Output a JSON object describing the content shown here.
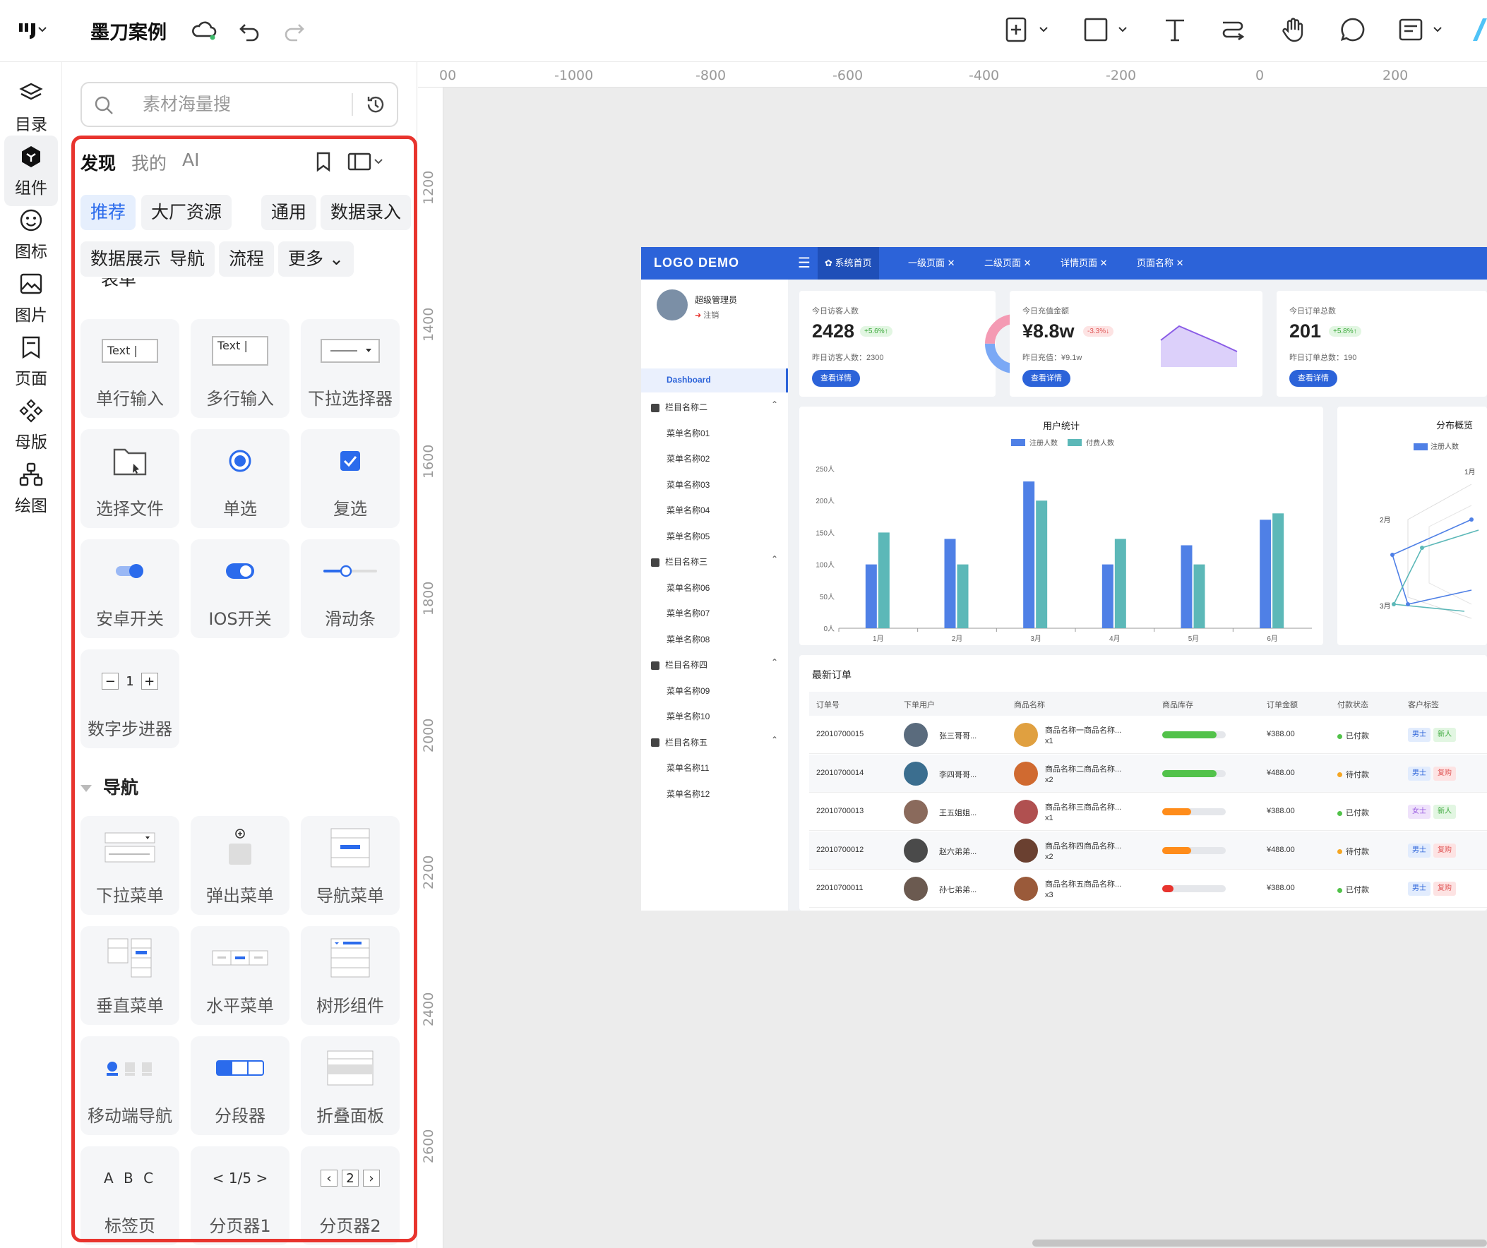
{
  "app": {
    "title": "墨刀案例"
  },
  "rail": [
    {
      "label": "目录",
      "icon": "layers-icon"
    },
    {
      "label": "组件",
      "icon": "component-icon",
      "active": true
    },
    {
      "label": "图标",
      "icon": "smiley-icon"
    },
    {
      "label": "图片",
      "icon": "image-icon"
    },
    {
      "label": "页面",
      "icon": "page-icon"
    },
    {
      "label": "母版",
      "icon": "master-icon"
    },
    {
      "label": "绘图",
      "icon": "draw-icon"
    }
  ],
  "rail_more": "···",
  "panel": {
    "search_placeholder": "素材海量搜",
    "tabs": [
      "发现",
      "我的",
      "AI"
    ],
    "chips": [
      "推荐",
      "大厂资源",
      "通用",
      "数据录入",
      "数据展示",
      "导航",
      "流程",
      "更多"
    ],
    "section_cut": "表单",
    "form_cards": [
      {
        "label": "单行输入",
        "preview": "Text |"
      },
      {
        "label": "多行输入",
        "preview": "Text |"
      },
      {
        "label": "下拉选择器"
      },
      {
        "label": "选择文件"
      },
      {
        "label": "单选"
      },
      {
        "label": "复选"
      },
      {
        "label": "安卓开关"
      },
      {
        "label": "IOS开关"
      },
      {
        "label": "滑动条"
      },
      {
        "label": "数字步进器",
        "preview": "1"
      }
    ],
    "nav_section": "导航",
    "nav_cards": [
      {
        "label": "下拉菜单"
      },
      {
        "label": "弹出菜单"
      },
      {
        "label": "导航菜单"
      },
      {
        "label": "垂直菜单"
      },
      {
        "label": "水平菜单"
      },
      {
        "label": "树形组件"
      },
      {
        "label": "移动端导航"
      },
      {
        "label": "分段器"
      },
      {
        "label": "折叠面板"
      },
      {
        "label": "标签页",
        "preview": "A B C"
      },
      {
        "label": "分页器1",
        "preview": "< 1/5 >"
      },
      {
        "label": "分页器2",
        "preview": "2"
      }
    ]
  },
  "rulers": {
    "top": [
      "00",
      "-1000",
      "-800",
      "-600",
      "-400",
      "-200",
      "0",
      "200"
    ],
    "left": [
      "1200",
      "1400",
      "1600",
      "1800",
      "2000",
      "2200",
      "2400",
      "2600"
    ]
  },
  "dashboard": {
    "logo": "LOGO DEMO",
    "tabs": [
      "系统首页",
      "一级页面 ✕",
      "二级页面 ✕",
      "详情页面 ✕",
      "页面名称 ✕"
    ],
    "user": {
      "name": "超级管理员",
      "logout": "注销"
    },
    "menu_active": "Dashboard",
    "menu": [
      {
        "group": "栏目名称二",
        "items": [
          "菜单名称01",
          "菜单名称02",
          "菜单名称03",
          "菜单名称04",
          "菜单名称05"
        ]
      },
      {
        "group": "栏目名称三",
        "items": [
          "菜单名称06",
          "菜单名称07",
          "菜单名称08"
        ]
      },
      {
        "group": "栏目名称四",
        "items": [
          "菜单名称09",
          "菜单名称10"
        ]
      },
      {
        "group": "栏目名称五",
        "items": [
          "菜单名称11",
          "菜单名称12"
        ]
      }
    ],
    "kpis": [
      {
        "title": "今日访客人数",
        "value": "2428",
        "badge": "+5.6%↑",
        "sub": "昨日访客人数：2300",
        "btn": "查看详情"
      },
      {
        "title": "今日充值金额",
        "value": "¥8.8w",
        "badge": "-3.3%↓",
        "sub": "昨日充值：¥9.1w",
        "btn": "查看详情"
      },
      {
        "title": "今日订单总数",
        "value": "201",
        "badge": "+5.8%↑",
        "sub": "昨日订单总数：190",
        "btn": "查看详情"
      }
    ],
    "radar": {
      "title": "分布概览",
      "legend": "注册人数",
      "axes": [
        "1月",
        "2月",
        "3月"
      ]
    },
    "orders": {
      "title": "最新订单",
      "headers": [
        "订单号",
        "下单用户",
        "商品名称",
        "商品库存",
        "订单金额",
        "付款状态",
        "客户标签"
      ],
      "rows": [
        {
          "id": "22010700015",
          "user": "张三哥哥...",
          "product": "商品名称一商品名称...",
          "qty": "x1",
          "stock": 0.85,
          "stock_color": "#52c24a",
          "amount": "¥388.00",
          "status": "已付款",
          "status_color": "#52c24a",
          "tag1": "男士",
          "tag2": "新人"
        },
        {
          "id": "22010700014",
          "user": "李四哥哥...",
          "product": "商品名称二商品名称...",
          "qty": "x2",
          "stock": 0.85,
          "stock_color": "#52c24a",
          "amount": "¥488.00",
          "status": "待付款",
          "status_color": "#f5a623",
          "tag1": "男士",
          "tag2": "复购"
        },
        {
          "id": "22010700013",
          "user": "王五姐姐...",
          "product": "商品名称三商品名称...",
          "qty": "x1",
          "stock": 0.45,
          "stock_color": "#ff8c1a",
          "amount": "¥388.00",
          "status": "已付款",
          "status_color": "#52c24a",
          "tag1": "女士",
          "tag2": "新人"
        },
        {
          "id": "22010700012",
          "user": "赵六弟弟...",
          "product": "商品名称四商品名称...",
          "qty": "x2",
          "stock": 0.45,
          "stock_color": "#ff8c1a",
          "amount": "¥488.00",
          "status": "待付款",
          "status_color": "#f5a623",
          "tag1": "男士",
          "tag2": "复购"
        },
        {
          "id": "22010700011",
          "user": "孙七弟弟...",
          "product": "商品名称五商品名称...",
          "qty": "x3",
          "stock": 0.18,
          "stock_color": "#e8342e",
          "amount": "¥388.00",
          "status": "已付款",
          "status_color": "#52c24a",
          "tag1": "男士",
          "tag2": "复购"
        }
      ]
    }
  },
  "chart_data": {
    "type": "bar",
    "title": "用户统计",
    "categories": [
      "1月",
      "2月",
      "3月",
      "4月",
      "5月",
      "6月"
    ],
    "series": [
      {
        "name": "注册人数",
        "values": [
          100,
          140,
          230,
          100,
          130,
          170
        ],
        "color": "#4f80e6"
      },
      {
        "name": "付费人数",
        "values": [
          150,
          100,
          200,
          140,
          100,
          180
        ],
        "color": "#5cb8b8"
      }
    ],
    "yticks": [
      "0人",
      "50人",
      "100人",
      "150人",
      "200人",
      "250人"
    ],
    "ylim": [
      0,
      250
    ],
    "legend": "top",
    "grid": false
  }
}
